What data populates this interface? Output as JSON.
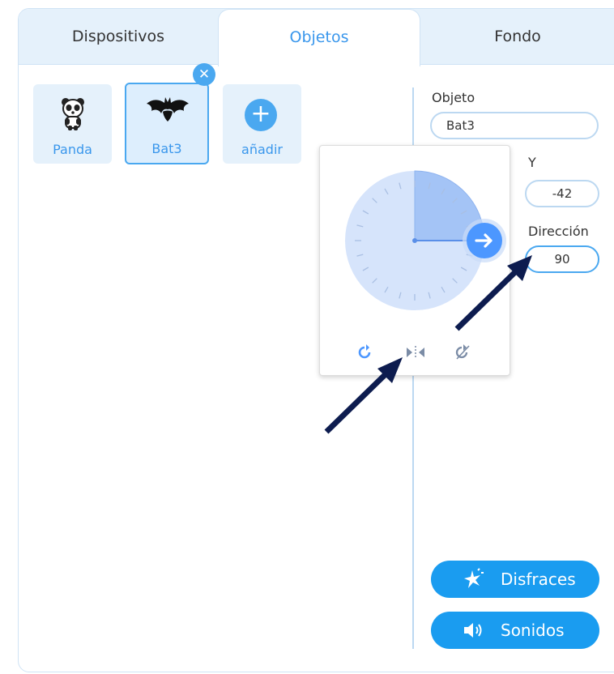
{
  "tabs": [
    {
      "label": "Dispositivos",
      "active": false
    },
    {
      "label": "Objetos",
      "active": true
    },
    {
      "label": "Fondo",
      "active": false
    }
  ],
  "sprites": [
    {
      "label": "Panda",
      "icon": "panda-icon",
      "selected": false
    },
    {
      "label": "Bat3",
      "icon": "bat-icon",
      "selected": true
    }
  ],
  "add_tile": {
    "label": "añadir",
    "icon": "plus-icon"
  },
  "properties": {
    "object_label": "Objeto",
    "object_value": "Bat3",
    "y_label": "Y",
    "y_value": "-42",
    "direction_label": "Dirección",
    "direction_value": "90"
  },
  "direction_dial": {
    "direction_degrees": 90,
    "rotation_modes": [
      "rotate-all-around-icon",
      "left-right-flip-icon",
      "dont-rotate-icon"
    ]
  },
  "buttons": {
    "costumes_label": "Disfraces",
    "sounds_label": "Sonidos"
  },
  "colors": {
    "accent": "#3a97ec",
    "button": "#1a9cf0",
    "tab_bg": "#e5f1fb",
    "annotation_arrow": "#0d1c4f"
  }
}
